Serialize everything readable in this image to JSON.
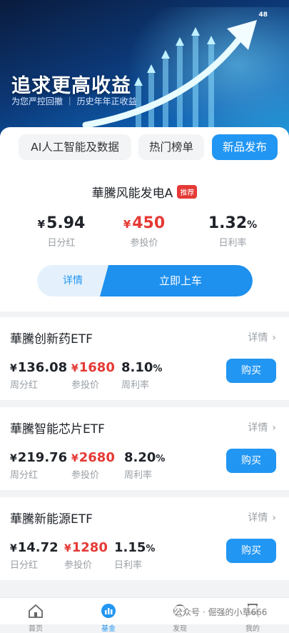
{
  "banner": {
    "title": "追求更高收益",
    "subtitle": "为您严控回撤 ｜ 历史年年正收益",
    "corner_badge": "48"
  },
  "tabs": [
    {
      "label": "AI人工智能及数据",
      "active": false
    },
    {
      "label": "热门榜单",
      "active": false
    },
    {
      "label": "新品发布",
      "active": true
    }
  ],
  "featured": {
    "name": "華騰风能发电A",
    "tag": "推荐",
    "stats": [
      {
        "currency": "¥",
        "value": "5.94",
        "label": "日分红",
        "color": "#1f2329"
      },
      {
        "currency": "¥",
        "value": "450",
        "label": "参投价",
        "color": "#e53935"
      },
      {
        "currency": "",
        "value": "1.32",
        "suffix": "%",
        "label": "日利率",
        "color": "#1f2329"
      }
    ],
    "detail_label": "详情",
    "go_label": "立即上车"
  },
  "products": [
    {
      "name": "華騰创新药ETF",
      "more_label": "详情",
      "dividend": "136.08",
      "dividend_label": "周分红",
      "price": "1680",
      "price_label": "参投价",
      "rate": "8.10",
      "rate_label": "周利率",
      "buy_label": "购买"
    },
    {
      "name": "華騰智能芯片ETF",
      "more_label": "详情",
      "dividend": "219.76",
      "dividend_label": "周分红",
      "price": "2680",
      "price_label": "参投价",
      "rate": "8.20",
      "rate_label": "周利率",
      "buy_label": "购买"
    },
    {
      "name": "華騰新能源ETF",
      "more_label": "详情",
      "dividend": "14.72",
      "dividend_label": "日分红",
      "price": "1280",
      "price_label": "参投价",
      "rate": "1.15",
      "rate_label": "日利率",
      "buy_label": "购买"
    }
  ],
  "currency_symbol": "¥",
  "percent_symbol": "%",
  "chevron": "›",
  "nav": [
    {
      "label": "首页",
      "icon": "home-icon",
      "active": false
    },
    {
      "label": "基金",
      "icon": "fund-icon",
      "active": true
    },
    {
      "label": "发现",
      "icon": "discover-icon",
      "active": false
    },
    {
      "label": "我的",
      "icon": "profile-icon",
      "active": false
    }
  ],
  "watermark": "公众号 · 倔强的小草666",
  "colors": {
    "accent": "#2196f3",
    "red": "#e53935"
  }
}
